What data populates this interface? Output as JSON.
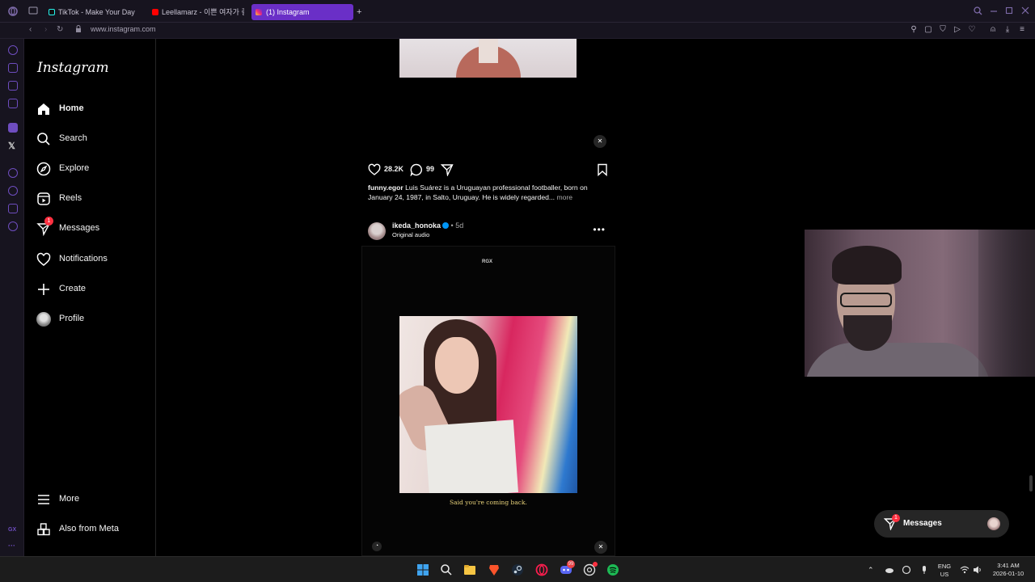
{
  "browser": {
    "tabs": [
      {
        "label": "TikTok - Make Your Day"
      },
      {
        "label": "Leellamarz - 이쁜 여자가 좋아"
      },
      {
        "label": "(1) Instagram"
      }
    ],
    "new_tab_symbol": "+",
    "url": "www.instagram.com"
  },
  "ig": {
    "logo": "Instagram",
    "nav": [
      {
        "label": "Home",
        "icon": "home-icon"
      },
      {
        "label": "Search",
        "icon": "search-icon"
      },
      {
        "label": "Explore",
        "icon": "compass-icon"
      },
      {
        "label": "Reels",
        "icon": "reels-icon"
      },
      {
        "label": "Messages",
        "icon": "messenger-icon",
        "badge": "1"
      },
      {
        "label": "Notifications",
        "icon": "heart-icon"
      },
      {
        "label": "Create",
        "icon": "plus-icon"
      },
      {
        "label": "Profile",
        "icon": "avatar"
      }
    ],
    "more_label": "More",
    "meta_label": "Also from Meta"
  },
  "post1": {
    "likes": "28.2K",
    "comments": "99",
    "caption_user": "funny.egor",
    "caption_text": "Luis Suárez is a Uruguayan professional footballer, born on January 24, 1987, in Salto, Uruguay. He is widely regarded...",
    "more_label": "more"
  },
  "post2": {
    "username": "ikeda_honoka",
    "age": "• 5d",
    "audio": "Original audio",
    "watermark": "RGX",
    "subtitle": "Said you're coming back."
  },
  "messages_pill": {
    "label": "Messages",
    "badge": "1"
  },
  "system": {
    "lang": "ENG",
    "region": "US",
    "time": "3:41 AM",
    "date": "2026-01-10",
    "discord_badge": "99"
  },
  "colors": {
    "opera_accent": "#6a2fc7",
    "ig_background": "#000000",
    "notification_red": "#ff3040",
    "verified_blue": "#0095f6"
  }
}
